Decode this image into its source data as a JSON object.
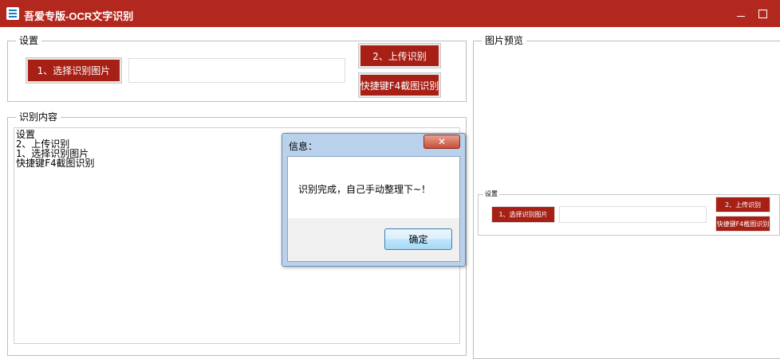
{
  "window": {
    "title": "吾爱专版-OCR文字识别",
    "accent_color": "#b3281e",
    "icon": "app-logo-icon",
    "controls": [
      "minimize-icon",
      "maximize-icon"
    ]
  },
  "settings": {
    "legend": "设置",
    "select_button": "1、选择识别图片",
    "path_value": "",
    "upload_button": "2、上传识别",
    "screenshot_button": "快捷键F4截图识别"
  },
  "result": {
    "legend": "识别内容",
    "lines": [
      "设置",
      "2、上传识别",
      "1、选择识别图片",
      "快捷键F4截图识别"
    ]
  },
  "preview": {
    "legend": "图片预览",
    "thumb": {
      "legend": "设置",
      "select_button": "1、选择识别图片",
      "upload_button": "2、上传识别",
      "screenshot_button": "快捷键F4截图识别"
    }
  },
  "dialog": {
    "title": "信息：",
    "close_label": "✕",
    "message": "识别完成，自己手动整理下~！",
    "ok_button": "确定"
  }
}
